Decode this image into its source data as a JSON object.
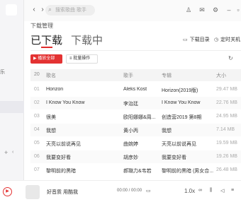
{
  "sidebar": {
    "frag_top": "乐",
    "plus": "+",
    "caret": "‹"
  },
  "topbar": {
    "back": "‹",
    "forward": "›",
    "search_placeholder": "搜索歌曲 歌手",
    "icons": [
      "shirt-icon",
      "mail-icon",
      "settings-icon",
      "minimize-icon",
      "maximize-icon"
    ]
  },
  "page": {
    "title": "下载管理",
    "tabs": [
      {
        "label": "已下载",
        "active": true
      },
      {
        "label": "下载中",
        "active": false
      }
    ],
    "right_actions": [
      {
        "label": "下载目录"
      },
      {
        "label": "定时关机"
      }
    ]
  },
  "toolbar": {
    "play_all": "播放全部",
    "batch": "批量操作"
  },
  "table": {
    "count": "20",
    "headers": {
      "title": "歌名",
      "artist": "歌手",
      "album": "专辑",
      "size": "大小"
    },
    "rows": [
      {
        "num": "01",
        "title": "Horizon",
        "artist": "Aleks Kost",
        "album": "Horizon(2019版)",
        "size": "29.47 MB"
      },
      {
        "num": "02",
        "title": "I Know You Know",
        "artist": "李治廷",
        "album": "I Know You Know",
        "size": "22.76 MB"
      },
      {
        "num": "03",
        "title": "很美",
        "artist": "欧阳娜娜&周...",
        "album": "创造营2019 第8期",
        "size": "24.95 MB"
      },
      {
        "num": "04",
        "title": "我想",
        "artist": "黄小丙",
        "album": "我想",
        "size": "7.14 MB"
      },
      {
        "num": "05",
        "title": "天亮以前说再见",
        "artist": "曲婉婷",
        "album": "天亮以前说再见",
        "size": "19.59 MB"
      },
      {
        "num": "06",
        "title": "我要变好看",
        "artist": "胡彦妙",
        "album": "我要变好看",
        "size": "19.26 MB"
      },
      {
        "num": "07",
        "title": "黎明前的黑暗",
        "artist": "郝璐力&韦若",
        "album": "黎明前的黑暗 (男女合...",
        "size": "26.48 MB"
      }
    ]
  },
  "player": {
    "title": "好音质 用酷我",
    "time": "00:00 / 00:00",
    "speed": "1.0x"
  }
}
